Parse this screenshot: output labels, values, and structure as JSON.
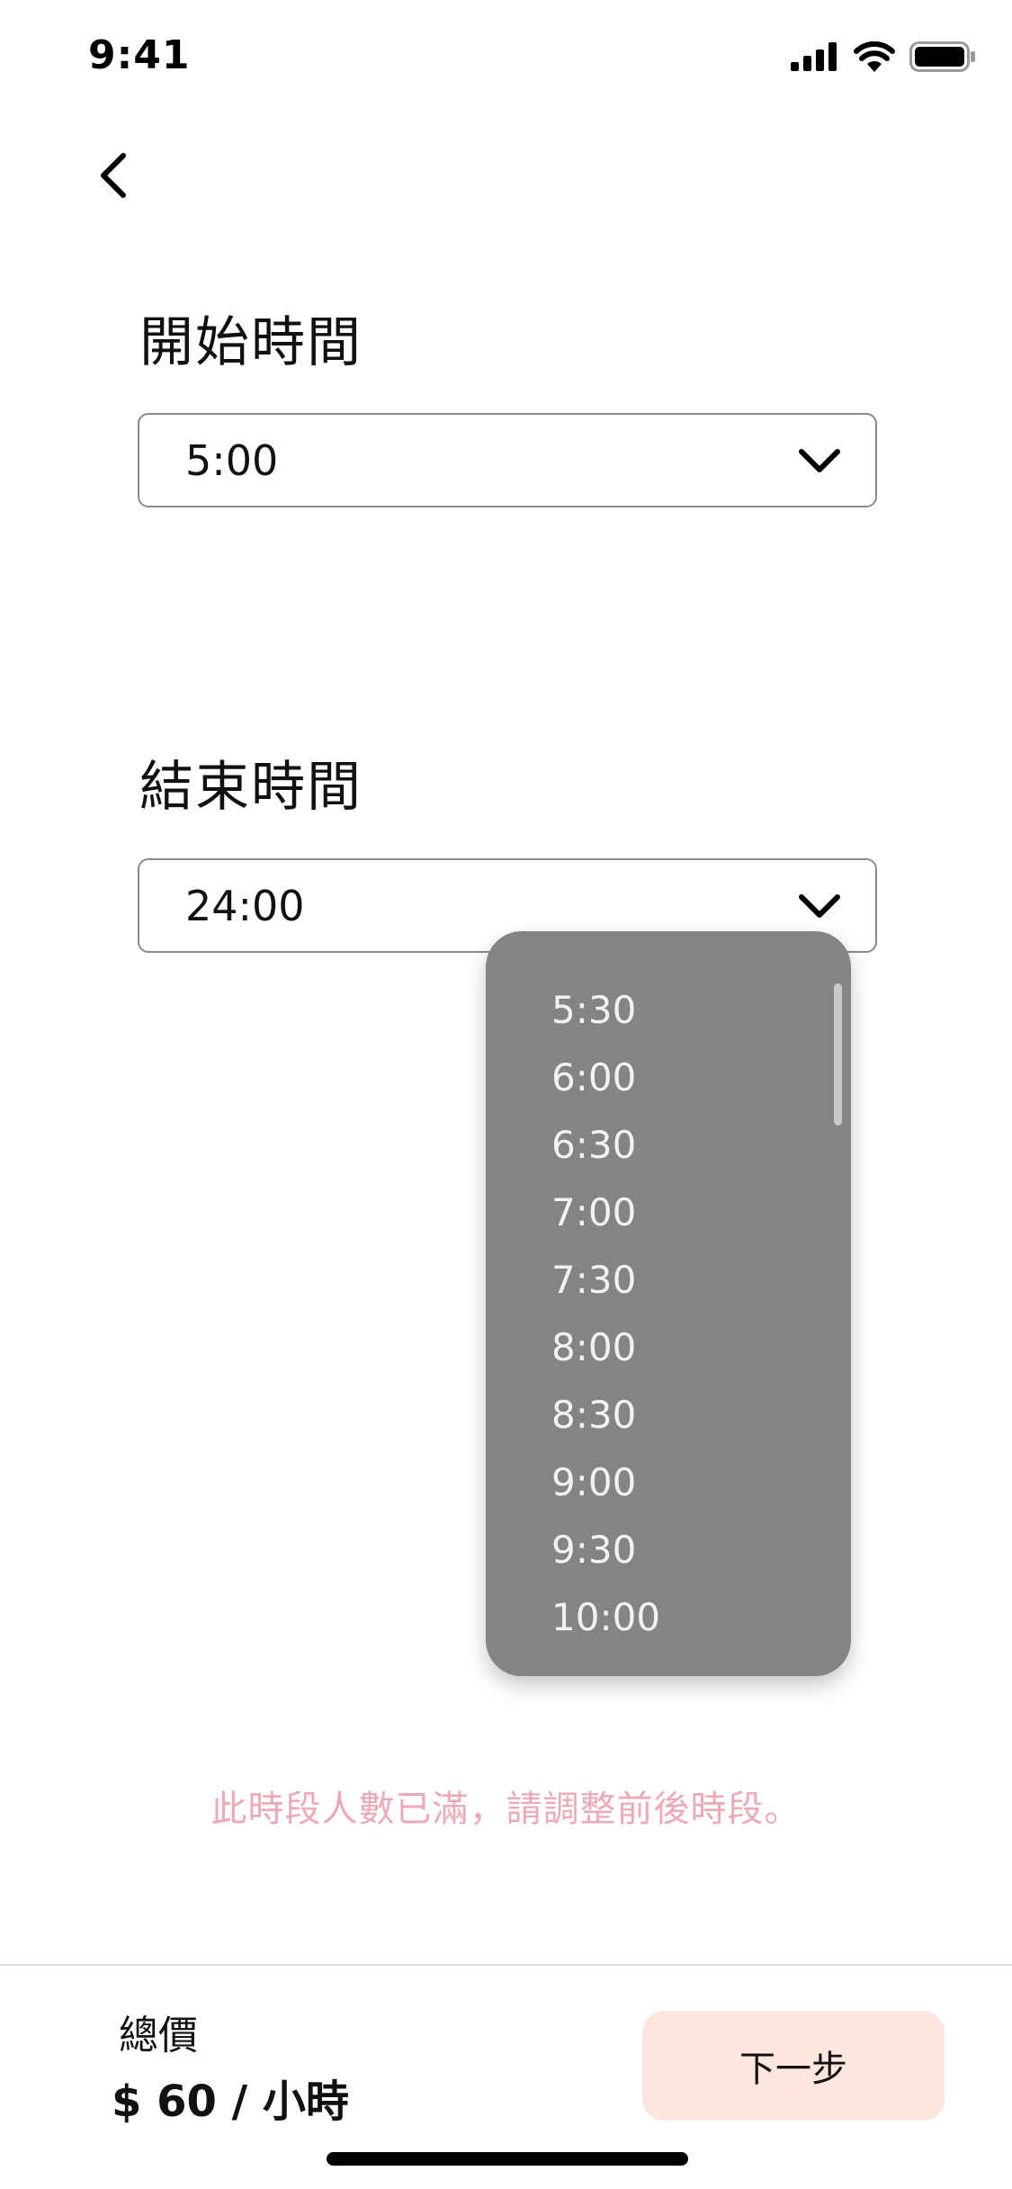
{
  "status_bar": {
    "time": "9:41",
    "icons": [
      "cellular-signal-icon",
      "wifi-icon",
      "battery-icon"
    ]
  },
  "nav": {
    "back_icon": "chevron-left-icon"
  },
  "start_time": {
    "title": "開始時間",
    "value": "5:00"
  },
  "end_time": {
    "title": "結束時間",
    "value": "24:00",
    "options": [
      "5:30",
      "6:00",
      "6:30",
      "7:00",
      "7:30",
      "8:00",
      "8:30",
      "9:00",
      "9:30",
      "10:00"
    ]
  },
  "warning_text": "此時段人數已滿，請調整前後時段。",
  "footer": {
    "total_label": "總價",
    "total_price": "$ 60 / 小時",
    "next_label": "下一步"
  },
  "colors": {
    "dropdown_bg": "#858484",
    "warning": "#eda9b7",
    "next_button_bg": "#fde6de"
  }
}
